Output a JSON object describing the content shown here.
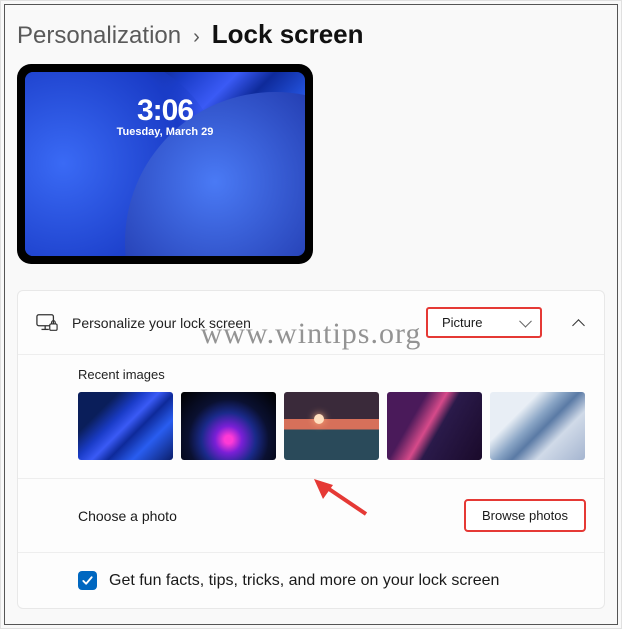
{
  "breadcrumb": {
    "parent": "Personalization",
    "sep": "›",
    "current": "Lock screen"
  },
  "preview": {
    "time": "3:06",
    "date": "Tuesday, March 29"
  },
  "personalize": {
    "label": "Personalize your lock screen",
    "dropdown_value": "Picture"
  },
  "recent": {
    "title": "Recent images"
  },
  "choose": {
    "label": "Choose a photo",
    "button": "Browse photos"
  },
  "funfacts": {
    "label": "Get fun facts, tips, tricks, and more on your lock screen",
    "checked": true
  },
  "watermark": "www.wintips.org"
}
